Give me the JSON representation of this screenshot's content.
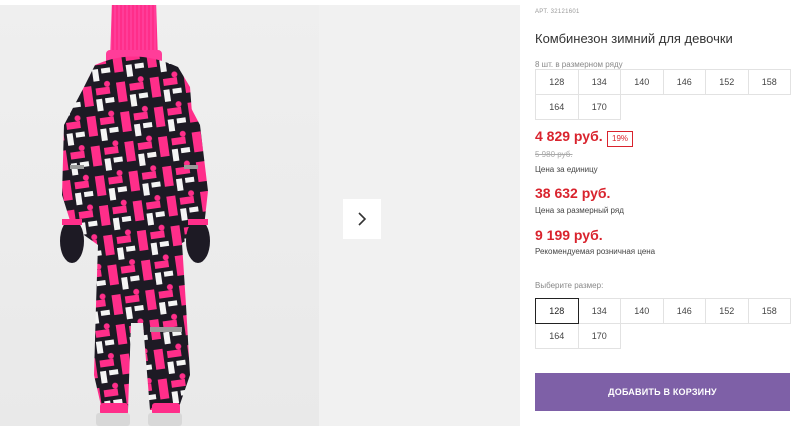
{
  "product": {
    "article": "АРТ. 32121601",
    "title": "Комбинезон зимний для девочки"
  },
  "size_row": {
    "caption": "8 шт. в размерном ряду",
    "sizes": [
      "128",
      "134",
      "140",
      "146",
      "152",
      "158",
      "164",
      "170"
    ]
  },
  "pricing": {
    "unit_price": "4 829 руб.",
    "discount": "19%",
    "old_price": "5 980 руб.",
    "unit_caption": "Цена за единицу",
    "row_price": "38 632 руб.",
    "row_caption": "Цена за размерный ряд",
    "retail_price": "9 199 руб.",
    "retail_caption": "Рекомендуемая розничная цена"
  },
  "size_select": {
    "label": "Выберите размер:",
    "sizes": [
      "128",
      "134",
      "140",
      "146",
      "152",
      "158",
      "164",
      "170"
    ],
    "selected": "128"
  },
  "actions": {
    "add_to_cart": "ДОБАВИТЬ В КОРЗИНУ"
  },
  "colors": {
    "price_red": "#d9232d",
    "button_purple": "#7e60a7",
    "suit_pink": "#ff2e8a",
    "suit_dark": "#1d1a24"
  },
  "icons": {
    "next": "chevron-right-icon"
  }
}
